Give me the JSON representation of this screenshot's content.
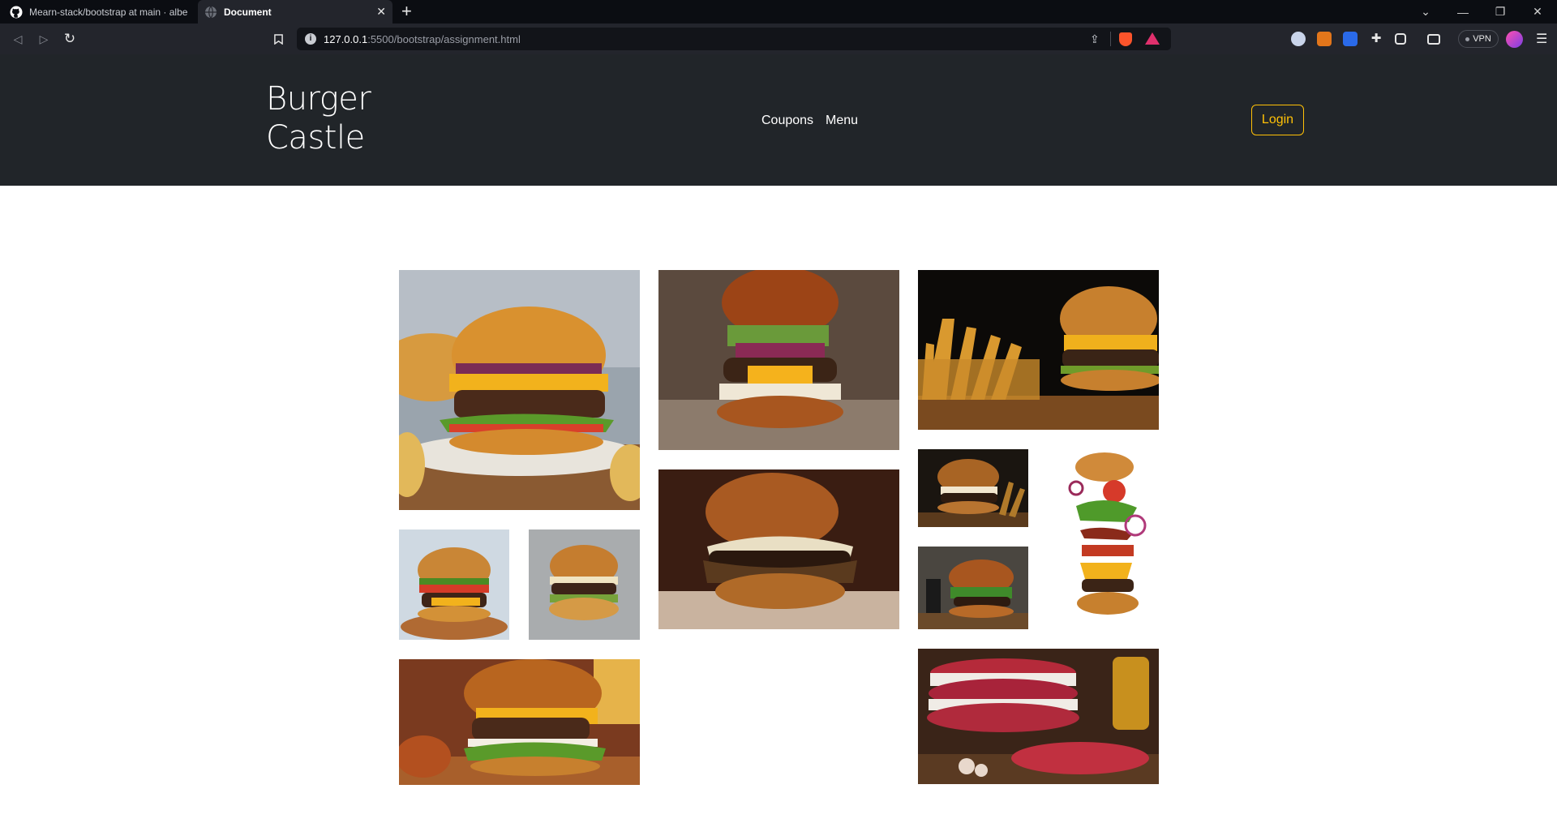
{
  "browser": {
    "tabs": [
      {
        "title": "Mearn-stack/bootstrap at main · albert",
        "icon": "github-icon"
      },
      {
        "title": "Document",
        "icon": "globe-icon"
      }
    ],
    "url_host": "127.0.0.1",
    "url_path": ":5500/bootstrap/assignment.html",
    "vpn_label": "VPN"
  },
  "site": {
    "brand_line1": "Burger",
    "brand_line2": "Castle",
    "nav_links": [
      "Coupons",
      "Menu"
    ],
    "login_label": "Login",
    "accent_color": "#ffc107",
    "navbar_color": "#212529"
  },
  "gallery": {
    "images": [
      {
        "name": "burger-cheese-classic-image"
      },
      {
        "name": "burger-pickles-image"
      },
      {
        "name": "burger-fries-board-image"
      },
      {
        "name": "burger-small-cheese-image"
      },
      {
        "name": "burger-small-grey-image"
      },
      {
        "name": "burger-mushroom-image"
      },
      {
        "name": "burger-fries-dark-image"
      },
      {
        "name": "burger-floating-ingredients-image"
      },
      {
        "name": "burger-rustic-image"
      },
      {
        "name": "burger-brioche-image"
      },
      {
        "name": "raw-patties-image"
      }
    ]
  }
}
